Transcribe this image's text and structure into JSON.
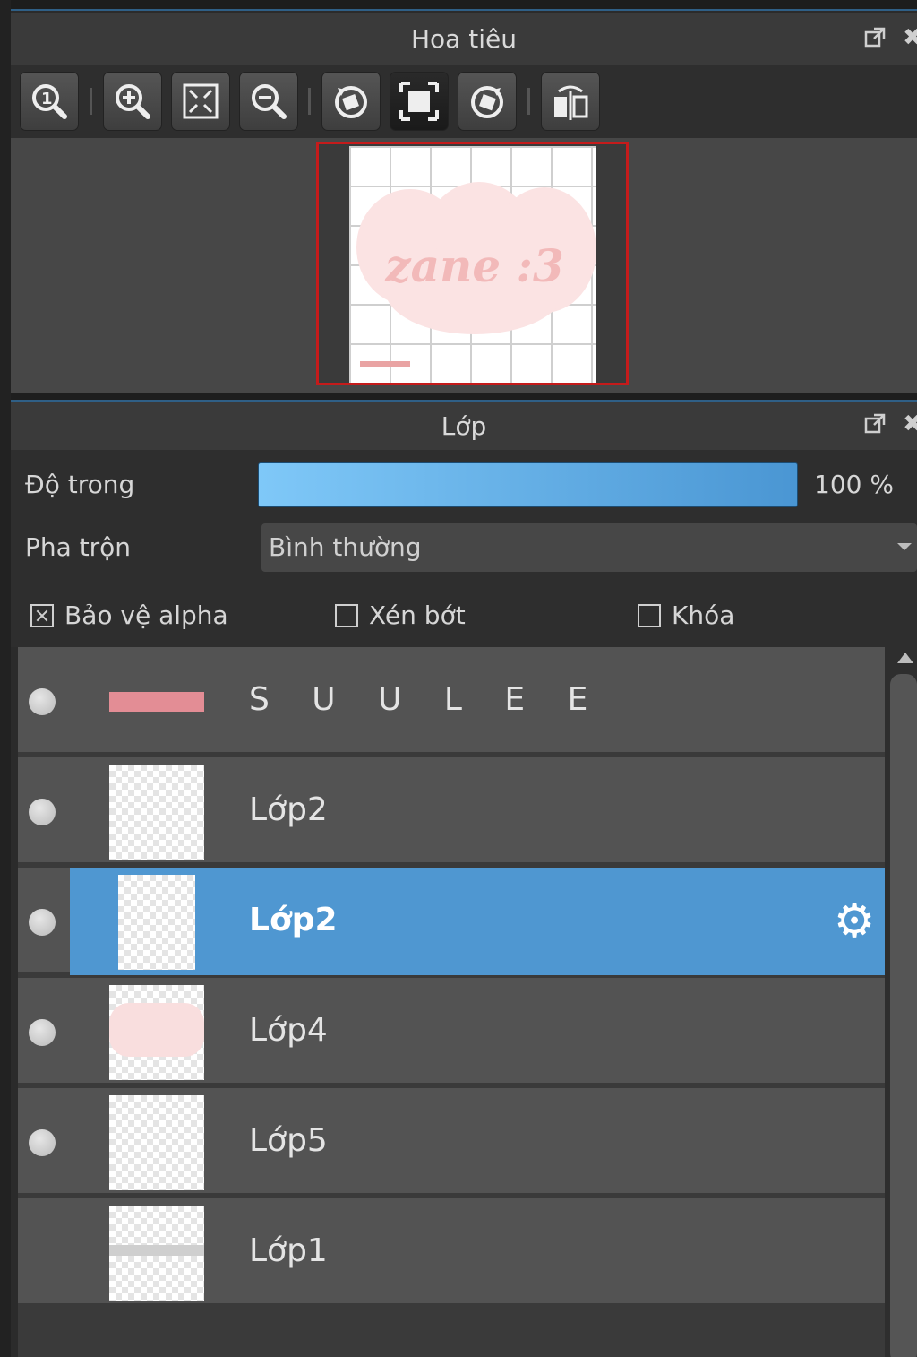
{
  "navigator": {
    "title": "Hoa tiêu",
    "toolbar": [
      "zoom-actual-icon",
      "zoom-in-icon",
      "fit-screen-icon",
      "zoom-out-icon",
      "rotate-left-icon",
      "fullscreen-icon",
      "rotate-right-icon",
      "flip-horizontal-icon"
    ],
    "preview": {
      "text": "zane :3",
      "border_color": "#c51b1b"
    }
  },
  "layers_panel": {
    "title": "Lớp",
    "opacity": {
      "label": "Độ trong",
      "value": "100 %",
      "fill": 1.0
    },
    "blend": {
      "label": "Pha trộn",
      "value": "Bình thường"
    },
    "checkboxes": [
      {
        "label": "Bảo vệ alpha",
        "checked": true
      },
      {
        "label": "Xén bớt",
        "checked": false
      },
      {
        "label": "Khóa",
        "checked": false
      }
    ],
    "layers": [
      {
        "name": "S U U L E E",
        "visible": true,
        "selected": false
      },
      {
        "name": "Lớp2",
        "visible": true,
        "selected": false
      },
      {
        "name": "Lớp2",
        "visible": true,
        "selected": true
      },
      {
        "name": "Lớp4",
        "visible": true,
        "selected": false
      },
      {
        "name": "Lớp5",
        "visible": true,
        "selected": false
      },
      {
        "name": "Lớp1",
        "visible": false,
        "selected": false
      }
    ]
  },
  "colors": {
    "accent": "#4f97d1",
    "selection_border": "#c51b1b",
    "panel_bg": "#2e2e2e"
  }
}
